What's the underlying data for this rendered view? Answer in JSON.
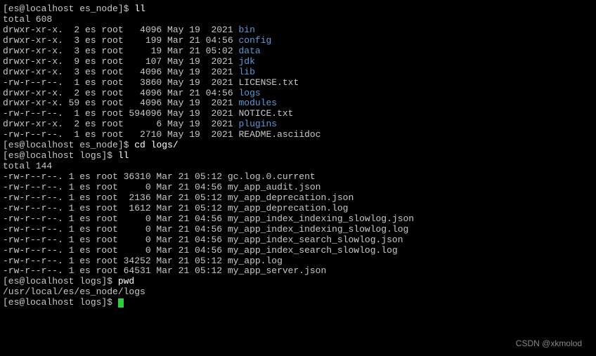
{
  "prompts": {
    "p1": "[es@localhost es_node]$ ",
    "p2": "[es@localhost logs]$ "
  },
  "cmds": {
    "ll": "ll",
    "cd_logs": "cd logs/",
    "pwd": "pwd",
    "empty": ""
  },
  "totals": {
    "t1": "total 608",
    "t2": "total 144"
  },
  "pwd_output": "/usr/local/es/es_node/logs",
  "ls1": [
    {
      "meta": "drwxr-xr-x.  2 es root   4096 May 19  2021 ",
      "name": "bin",
      "dir": true
    },
    {
      "meta": "drwxr-xr-x.  3 es root    199 Mar 21 04:56 ",
      "name": "config",
      "dir": true
    },
    {
      "meta": "drwxr-xr-x.  3 es root     19 Mar 21 05:02 ",
      "name": "data",
      "dir": true
    },
    {
      "meta": "drwxr-xr-x.  9 es root    107 May 19  2021 ",
      "name": "jdk",
      "dir": true
    },
    {
      "meta": "drwxr-xr-x.  3 es root   4096 May 19  2021 ",
      "name": "lib",
      "dir": true
    },
    {
      "meta": "-rw-r--r--.  1 es root   3860 May 19  2021 ",
      "name": "LICENSE.txt",
      "dir": false
    },
    {
      "meta": "drwxr-xr-x.  2 es root   4096 Mar 21 04:56 ",
      "name": "logs",
      "dir": true
    },
    {
      "meta": "drwxr-xr-x. 59 es root   4096 May 19  2021 ",
      "name": "modules",
      "dir": true
    },
    {
      "meta": "-rw-r--r--.  1 es root 594096 May 19  2021 ",
      "name": "NOTICE.txt",
      "dir": false
    },
    {
      "meta": "drwxr-xr-x.  2 es root      6 May 19  2021 ",
      "name": "plugins",
      "dir": true
    },
    {
      "meta": "-rw-r--r--.  1 es root   2710 May 19  2021 ",
      "name": "README.asciidoc",
      "dir": false
    }
  ],
  "ls2": [
    {
      "meta": "-rw-r--r--. 1 es root 36310 Mar 21 05:12 ",
      "name": "gc.log.0.current",
      "dir": false
    },
    {
      "meta": "-rw-r--r--. 1 es root     0 Mar 21 04:56 ",
      "name": "my_app_audit.json",
      "dir": false
    },
    {
      "meta": "-rw-r--r--. 1 es root  2136 Mar 21 05:12 ",
      "name": "my_app_deprecation.json",
      "dir": false
    },
    {
      "meta": "-rw-r--r--. 1 es root  1612 Mar 21 05:12 ",
      "name": "my_app_deprecation.log",
      "dir": false
    },
    {
      "meta": "-rw-r--r--. 1 es root     0 Mar 21 04:56 ",
      "name": "my_app_index_indexing_slowlog.json",
      "dir": false
    },
    {
      "meta": "-rw-r--r--. 1 es root     0 Mar 21 04:56 ",
      "name": "my_app_index_indexing_slowlog.log",
      "dir": false
    },
    {
      "meta": "-rw-r--r--. 1 es root     0 Mar 21 04:56 ",
      "name": "my_app_index_search_slowlog.json",
      "dir": false
    },
    {
      "meta": "-rw-r--r--. 1 es root     0 Mar 21 04:56 ",
      "name": "my_app_index_search_slowlog.log",
      "dir": false
    },
    {
      "meta": "-rw-r--r--. 1 es root 34252 Mar 21 05:12 ",
      "name": "my_app.log",
      "dir": false
    },
    {
      "meta": "-rw-r--r--. 1 es root 64531 Mar 21 05:12 ",
      "name": "my_app_server.json",
      "dir": false
    }
  ],
  "watermark": "CSDN @xkmolod"
}
